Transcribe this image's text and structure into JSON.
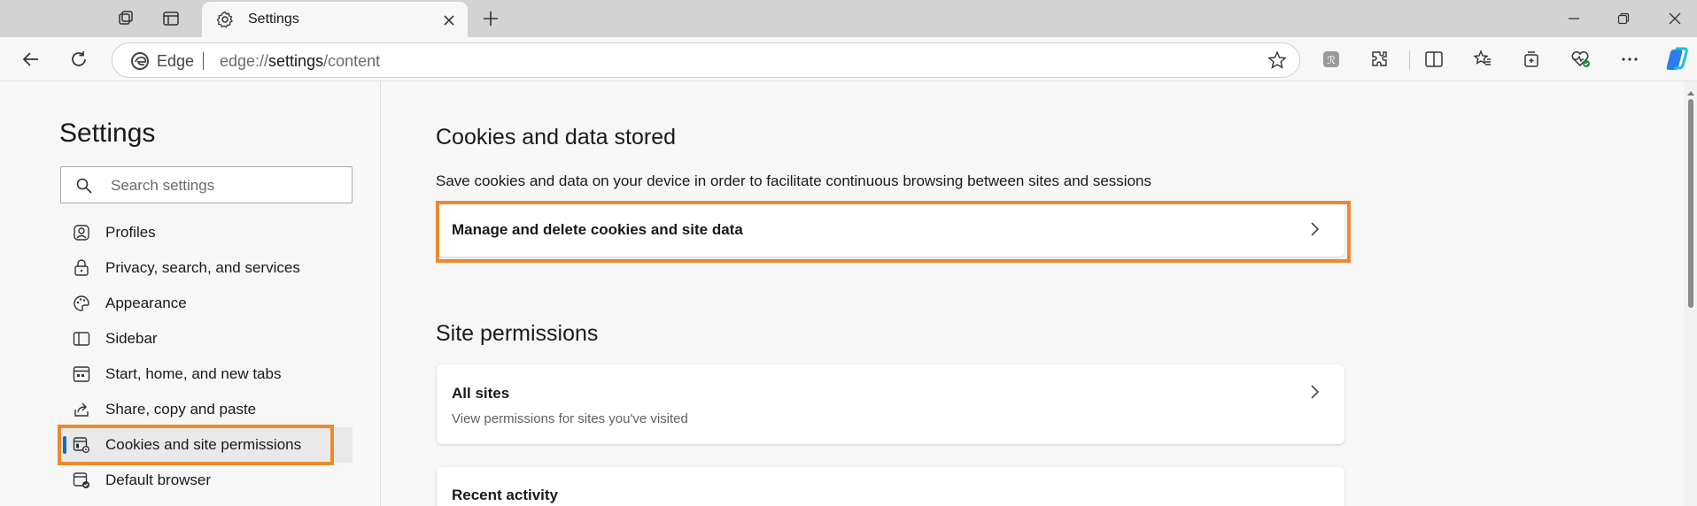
{
  "browser": {
    "tab_title": "Settings",
    "address_label": "Edge",
    "url_scheme": "edge://",
    "url_path": "settings",
    "url_rest": "/content"
  },
  "sidebar": {
    "title": "Settings",
    "search_placeholder": "Search settings",
    "items": [
      {
        "label": "Profiles",
        "icon": "profile-icon"
      },
      {
        "label": "Privacy, search, and services",
        "icon": "lock-icon"
      },
      {
        "label": "Appearance",
        "icon": "palette-icon"
      },
      {
        "label": "Sidebar",
        "icon": "sidebar-icon"
      },
      {
        "label": "Start, home, and new tabs",
        "icon": "home-tabs-icon"
      },
      {
        "label": "Share, copy and paste",
        "icon": "share-icon"
      },
      {
        "label": "Cookies and site permissions",
        "icon": "cookie-permissions-icon",
        "active": true
      },
      {
        "label": "Default browser",
        "icon": "default-browser-icon"
      }
    ]
  },
  "main": {
    "cookies_heading": "Cookies and data stored",
    "cookies_desc": "Save cookies and data on your device in order to facilitate continuous browsing between sites and sessions",
    "manage_cookies": "Manage and delete cookies and site data",
    "permissions_heading": "Site permissions",
    "all_sites_title": "All sites",
    "all_sites_sub": "View permissions for sites you've visited",
    "recent_activity_title": "Recent activity"
  },
  "colors": {
    "highlight": "#ea8a30",
    "accent": "#0f6cbd"
  }
}
